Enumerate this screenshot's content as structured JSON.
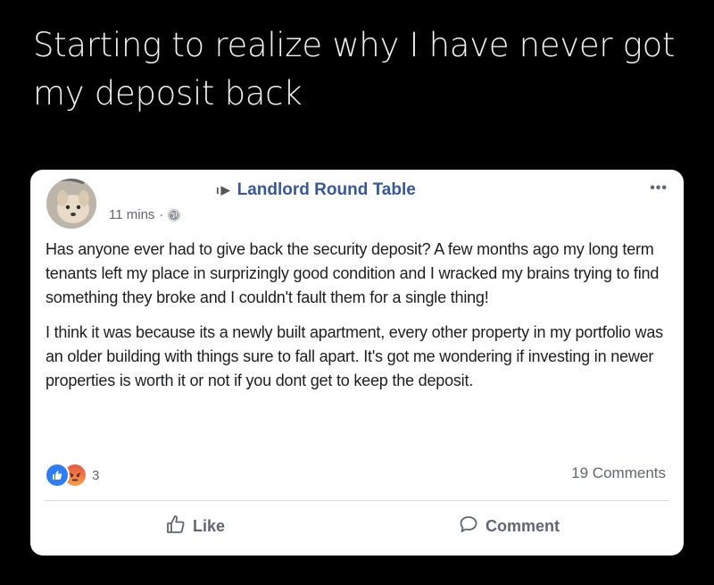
{
  "caption": "Starting to realize why I have never got my deposit back",
  "post": {
    "group_name": "Landlord Round Table",
    "time": "11 mins",
    "separator": "·",
    "paragraphs": [
      "Has anyone ever had to give back the security deposit? A few months ago my long term tenants left my place in surprizingly good condition and I wracked my brains trying to find something they broke and I couldn't fault them for a single thing!",
      "I think it was because its a newly built apartment, every other property in my portfolio was an older building with things sure to fall apart. It's got me wondering if investing in newer properties is worth it or not if you dont get to keep the deposit."
    ],
    "reaction_count": "3",
    "comments_count": "19 Comments",
    "actions": {
      "like_label": "Like",
      "comment_label": "Comment"
    }
  },
  "icons": {
    "more": "more-options-icon",
    "globe": "globe-icon",
    "like_reaction": "like-reaction-icon",
    "angry_reaction": "angry-reaction-icon",
    "thumbs_up": "thumbs-up-icon",
    "comment": "comment-bubble-icon"
  },
  "colors": {
    "group_link": "#365899",
    "like_blue": "#2e7cf6",
    "background": "#000000"
  }
}
